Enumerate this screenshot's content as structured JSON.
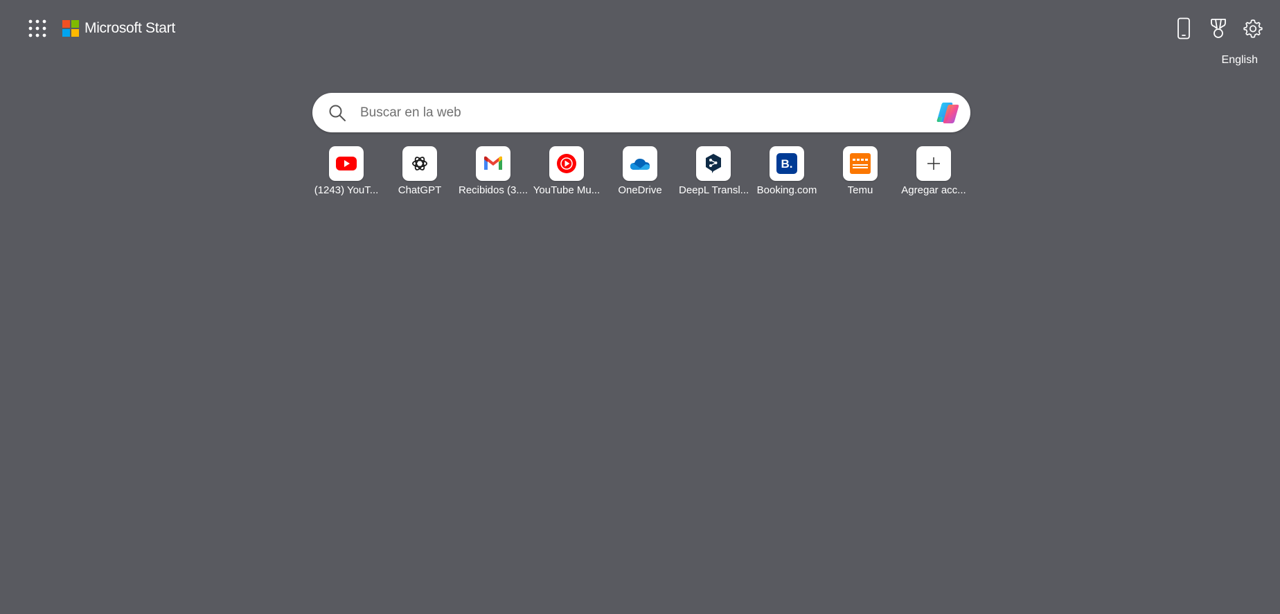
{
  "header": {
    "brand": "Microsoft Start",
    "language": "English",
    "icons": [
      "apps-grid-icon",
      "phone-icon",
      "trophy-icon",
      "gear-icon"
    ]
  },
  "search": {
    "placeholder": "Buscar en la web"
  },
  "quick_links": [
    {
      "label": "(1243) YouT...",
      "icon": "youtube-icon"
    },
    {
      "label": "ChatGPT",
      "icon": "chatgpt-icon"
    },
    {
      "label": "Recibidos (3....",
      "icon": "gmail-icon"
    },
    {
      "label": "YouTube Mu...",
      "icon": "youtube-music-icon"
    },
    {
      "label": "OneDrive",
      "icon": "onedrive-icon"
    },
    {
      "label": "DeepL Transl...",
      "icon": "deepl-icon"
    },
    {
      "label": "Booking.com",
      "icon": "booking-icon"
    },
    {
      "label": "Temu",
      "icon": "temu-icon"
    },
    {
      "label": "Agregar acc...",
      "icon": "plus-icon"
    }
  ],
  "colors": {
    "background": "#595a60",
    "youtube_red": "#ff0000",
    "booking_blue": "#003b95",
    "temu_orange": "#fb7701",
    "deepl_navy": "#0f2b46",
    "onedrive_blue": "#0364b8"
  }
}
